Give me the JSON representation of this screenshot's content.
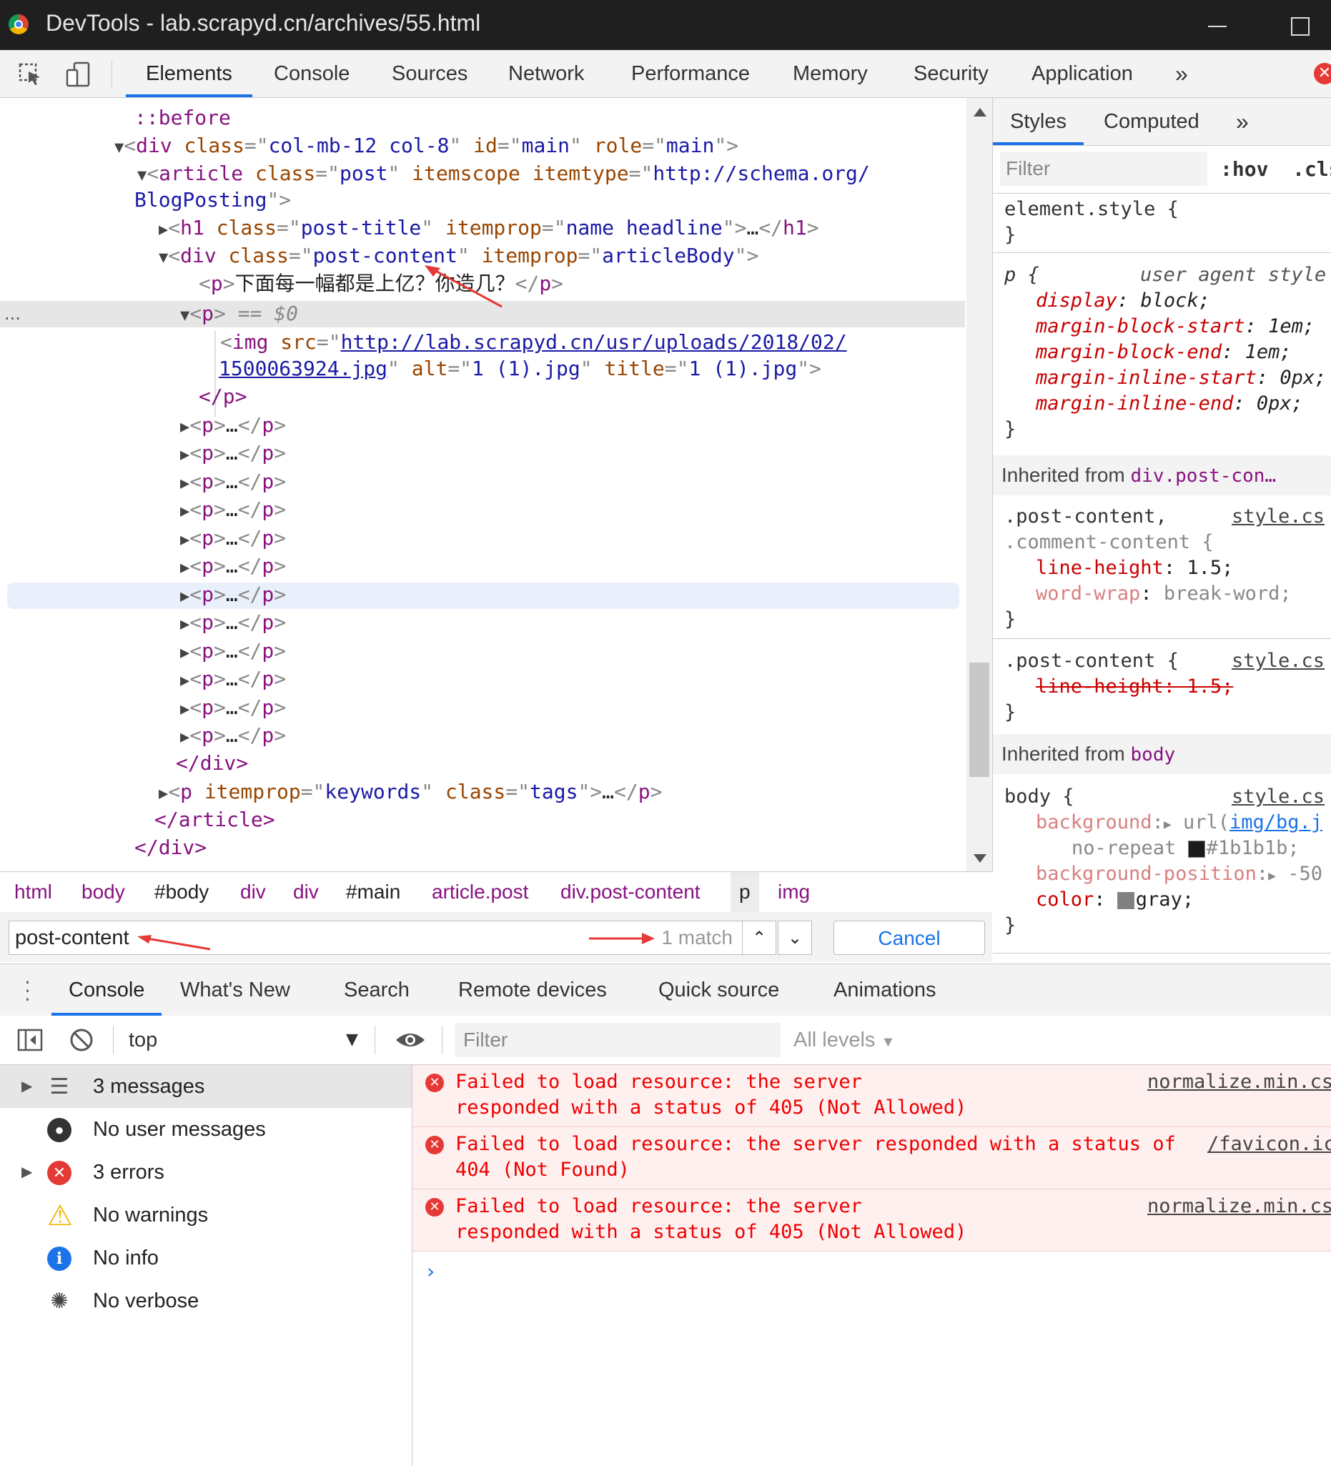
{
  "window": {
    "title": "DevTools - lab.scrapyd.cn/archives/55.html"
  },
  "main_tabs": [
    "Elements",
    "Console",
    "Sources",
    "Network",
    "Performance",
    "Memory",
    "Security",
    "Application"
  ],
  "more_tabs": "»",
  "dom": {
    "before": "::before",
    "div_open": {
      "tag": "div",
      "class_name": "class",
      "class_val": "col-mb-12 col-8",
      "id_name": "id",
      "id_val": "main",
      "role_name": "role",
      "role_val": "main"
    },
    "article": {
      "tag": "article",
      "class_name": "class",
      "class_val": "post",
      "scope": "itemscope",
      "type_name": "itemtype",
      "type_val_1": "http://schema.org/",
      "type_val_2": "BlogPosting"
    },
    "h1": {
      "tag": "h1",
      "class_name": "class",
      "class_val": "post-title",
      "prop_name": "itemprop",
      "prop_val": "name headline",
      "collapsed": "…"
    },
    "div_content": {
      "tag": "div",
      "class_name": "class",
      "class_val": "post-content",
      "prop_name": "itemprop",
      "prop_val": "articleBody"
    },
    "p_text": "下面每一幅都是上亿？你造几？",
    "selected_p": {
      "tag": "p",
      "marker": "== $0"
    },
    "img": {
      "tag": "img",
      "src_name": "src",
      "src_1": "http://lab.scrapyd.cn/usr/uploads/2018/02/",
      "src_2": "1500063924.jpg",
      "alt_name": "alt",
      "alt_val": "1 (1).jpg",
      "title_name": "title",
      "title_val": "1 (1).jpg"
    },
    "p_close": "</p>",
    "collapsed_p": "…",
    "div_close": "</div>",
    "p_tags": {
      "tag": "p",
      "prop_name": "itemprop",
      "prop_val": "keywords",
      "class_name": "class",
      "class_val": "tags",
      "collapsed": "…"
    },
    "article_close": "</article>",
    "div_close2": "</div>",
    "ellipsis": "..."
  },
  "breadcrumb": [
    "html",
    "body",
    "#body",
    "div",
    "div",
    "#main",
    "article.post",
    "div.post-content",
    "p",
    "img"
  ],
  "search": {
    "query": "post-content",
    "count": "1 match",
    "cancel": "Cancel"
  },
  "styles": {
    "tabs": [
      "Styles",
      "Computed"
    ],
    "more": "»",
    "filter_placeholder": "Filter",
    "hov": ":hov",
    "cls": ".cls",
    "element_style": "element.style {",
    "close_brace": "}",
    "ua_selector": "p {",
    "ua_label": "user agent style",
    "ua_props": [
      {
        "name": "display",
        "value": "block;"
      },
      {
        "name": "margin-block-start",
        "value": "1em;"
      },
      {
        "name": "margin-block-end",
        "value": "1em;"
      },
      {
        "name": "margin-inline-start",
        "value": "0px;"
      },
      {
        "name": "margin-inline-end",
        "value": "0px;"
      }
    ],
    "inherited_1_label": "Inherited from",
    "inherited_1_sel": "div.post-con…",
    "rule2_sel_1": ".post-content,",
    "rule2_sel_2": ".comment-content {",
    "rule2_src": "style.cs",
    "rule2_props": [
      {
        "name": "line-height",
        "value": "1.5;"
      },
      {
        "name": "word-wrap",
        "value": "break-word;"
      }
    ],
    "rule3_sel": ".post-content {",
    "rule3_src": "style.cs",
    "rule3_struck": "line-height: 1.5;",
    "inherited_2_label": "Inherited from",
    "inherited_2_sel": "body",
    "rule4_sel": "body {",
    "rule4_src": "style.cs",
    "bg_name": "background",
    "bg_val_prefix": "url(",
    "bg_url": "img/bg.j",
    "bg_val2": "no-repeat",
    "bg_color_text": "#1b1b1b;",
    "bg_pos_name": "background-position",
    "bg_pos_val": "-50",
    "color_name": "color",
    "color_val": "gray;",
    "colors": {
      "bg_swatch": "#1b1b1b",
      "gray_swatch": "#808080"
    }
  },
  "drawer_tabs": [
    "Console",
    "What's New",
    "Search",
    "Remote devices",
    "Quick source",
    "Animations"
  ],
  "console_toolbar": {
    "context": "top",
    "filter_placeholder": "Filter",
    "levels": "All levels"
  },
  "sidebar": [
    {
      "label": "3 messages",
      "icon": "list-icon"
    },
    {
      "label": "No user messages",
      "icon": "user-icon"
    },
    {
      "label": "3 errors",
      "icon": "error-icon"
    },
    {
      "label": "No warnings",
      "icon": "warning-icon"
    },
    {
      "label": "No info",
      "icon": "info-icon"
    },
    {
      "label": "No verbose",
      "icon": "verbose-icon"
    }
  ],
  "messages": [
    {
      "text": "Failed to load resource: the server responded with a status of 405 (Not Allowed)",
      "source": "normalize.min.cs"
    },
    {
      "text": "Failed to load resource: the server responded with a status of 404 (Not Found)",
      "source": "/favicon.ic"
    },
    {
      "text": "Failed to load resource: the server responded with a status of 405 (Not Allowed)",
      "source": "normalize.min.cs"
    }
  ],
  "prompt": "›"
}
